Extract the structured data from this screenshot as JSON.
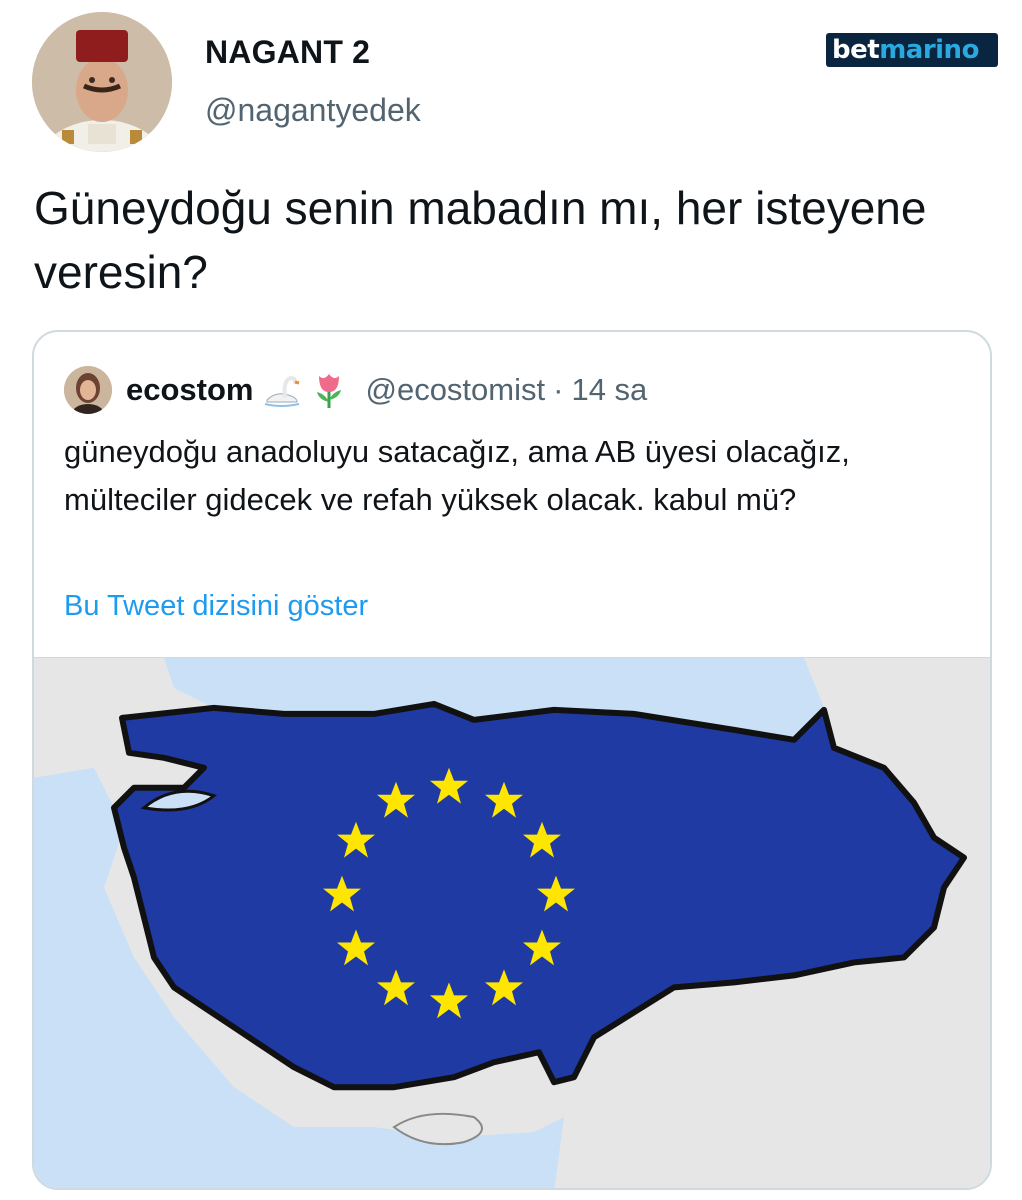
{
  "tweet": {
    "author": {
      "display_name": "NAGANT 2",
      "handle": "@nagantyedek",
      "avatar_icon": "profile-photo"
    },
    "text": "Güneydoğu senin mabadın mı, her isteyene veresin?"
  },
  "watermark": {
    "part1": "bet",
    "part2": "marino",
    "color_dark": "#0a2540",
    "color_accent": "#29a9e0"
  },
  "quoted_tweet": {
    "author": {
      "display_name": "ecostom",
      "emojis": [
        "swan-emoji",
        "tulip-emoji"
      ],
      "handle": "@ecostomist",
      "separator": "·",
      "time": "14 sa"
    },
    "text": "güneydoğu anadoluyu satacağız, ama AB üyesi olacağız, mülteciler gidecek ve refah yüksek olacak. kabul mü?",
    "show_thread_label": "Bu Tweet dizisini göster",
    "media": {
      "description_icon": "turkey-eu-flag-map",
      "map_fill": "#1f3aa3",
      "star_color": "#ffe600",
      "sea_color": "#c9e0f7",
      "land_color": "#e6e6e6"
    }
  },
  "colors": {
    "text_primary": "#0f1419",
    "text_secondary": "#536471",
    "link": "#1d9bf0",
    "border": "#cfd9de"
  }
}
